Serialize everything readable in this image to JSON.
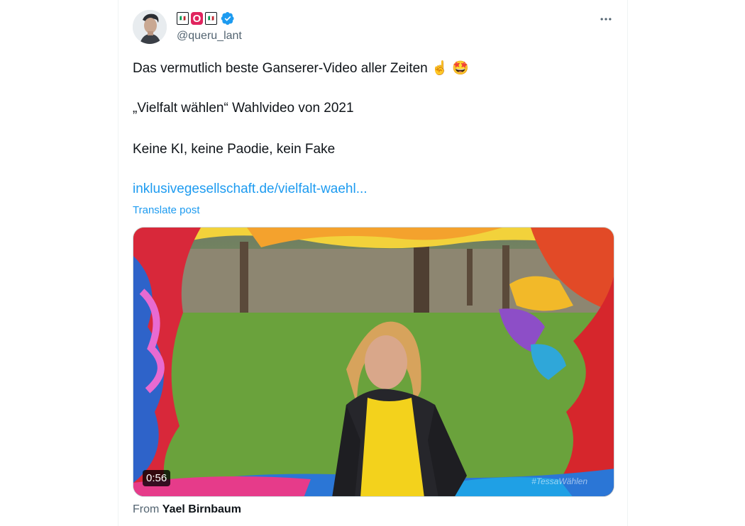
{
  "author": {
    "display_name_emojis": [
      "🇮🇹",
      "🅾️",
      "🇮🇹"
    ],
    "display_name_emoji_faces": [
      "🇮🇹",
      "O",
      "🇮🇹"
    ],
    "handle": "@queru_lant",
    "verified": true,
    "avatar_icon": "avatar-photo"
  },
  "post": {
    "line1": "Das vermutlich beste Ganserer-Video aller Zeiten",
    "line1_emojis": [
      "☝️",
      "🤩"
    ],
    "line2": "„Vielfalt wählen“ Wahlvideo von 2021",
    "line3": "Keine KI, keine Paodie, kein Fake",
    "link": "inklusivegesellschaft.de/vielfalt-waehl...",
    "translate_label": "Translate post"
  },
  "media": {
    "duration": "0:56",
    "watermark": "#TessaWählen"
  },
  "attribution": {
    "prefix": "From",
    "source": "Yael Birnbaum"
  },
  "colors": {
    "accent": "#1d9bf0",
    "text": "#0f1419",
    "secondary": "#536471",
    "border": "#eff3f4"
  }
}
